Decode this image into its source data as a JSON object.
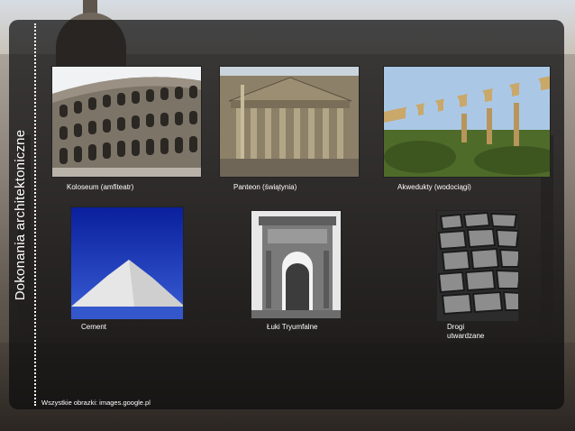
{
  "slide": {
    "side_title": "Dokonania architektoniczne",
    "footer": "Wszystkie obrazki: images.google.pl"
  },
  "items": [
    {
      "caption": "Koloseum (amfiteatr)",
      "image": "colosseum-photo"
    },
    {
      "caption": "Panteon (świątynia)",
      "image": "pantheon-photo"
    },
    {
      "caption": "Akwedukty (wodociągi)",
      "image": "aqueduct-photo"
    },
    {
      "caption": "Cement",
      "image": "cement-pile-photo"
    },
    {
      "caption": "Łuki Tryumfalne",
      "image": "triumphal-arch-photo"
    },
    {
      "caption": "Drogi utwardzane",
      "image": "paved-road-photo"
    }
  ],
  "colors": {
    "panel": "#0c0c0e",
    "text": "#ffffff"
  }
}
